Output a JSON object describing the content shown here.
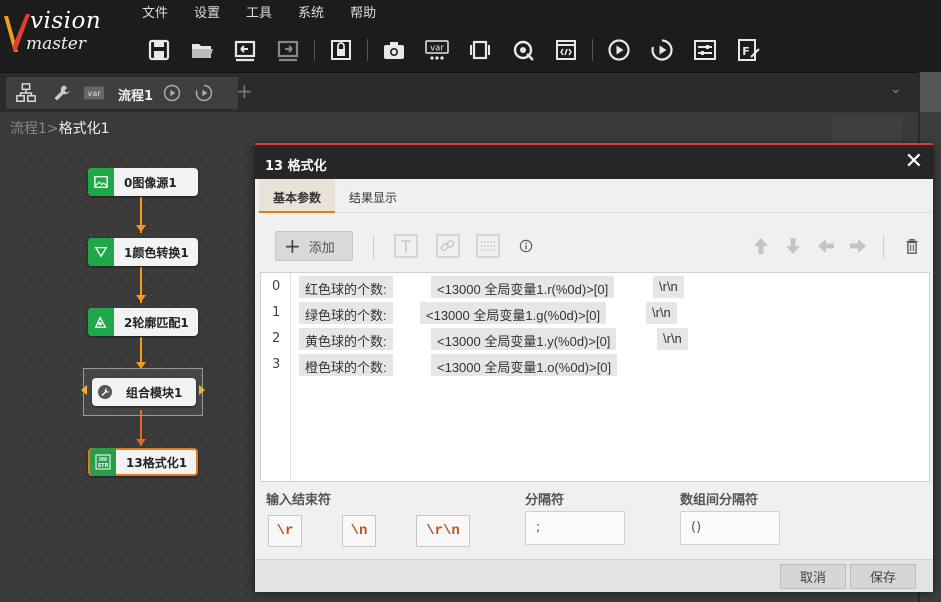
{
  "app": {
    "logo_text_top": "vision",
    "logo_text_bottom": "master"
  },
  "menu": [
    "文件",
    "设置",
    "工具",
    "系统",
    "帮助"
  ],
  "toolbar_icons": [
    "save-icon",
    "open-folder-icon",
    "import-icon",
    "export-icon",
    "lock-icon",
    "camera-icon",
    "variable-icon",
    "controller-icon",
    "global-trigger-icon",
    "script-icon",
    "run-once-icon",
    "run-loop-icon",
    "settings-icon",
    "form-icon"
  ],
  "process_tab": {
    "label": "流程1"
  },
  "breadcrumb": {
    "parent": "流程1",
    "separator": ">",
    "current": "格式化1"
  },
  "nodes": [
    {
      "label": "0图像源1",
      "icon": "image-icon"
    },
    {
      "label": "1颜色转换1",
      "icon": "color-convert-icon"
    },
    {
      "label": "2轮廓匹配1",
      "icon": "contour-match-icon"
    },
    {
      "label": "组合模块1",
      "icon": "wrench-icon"
    },
    {
      "label": "13格式化1",
      "icon": "str-icon"
    }
  ],
  "dialog": {
    "title": "13 格式化",
    "tabs": [
      "基本参数",
      "结果显示"
    ],
    "add_label": "添加",
    "lines": [
      {
        "num": "0",
        "label": "红色球的个数:",
        "expr": "<13000 全局变量1.r(%0d)>[0]",
        "term": "\\r\\n"
      },
      {
        "num": "1",
        "label": "绿色球的个数:",
        "expr": "<13000 全局变量1.g(%0d)>[0]",
        "term": "\\r\\n"
      },
      {
        "num": "2",
        "label": "黄色球的个数:",
        "expr": "<13000 全局变量1.y(%0d)>[0]",
        "term": "\\r\\n"
      },
      {
        "num": "3",
        "label": "橙色球的个数:",
        "expr": "<13000 全局变量1.o(%0d)>[0]",
        "term": ""
      }
    ],
    "input_end_label": "输入结束符",
    "end_buttons": [
      "\\r",
      "\\n",
      "\\r\\n"
    ],
    "separator_label": "分隔符",
    "separator_value": ";",
    "array_separator_label": "数组间分隔符",
    "array_separator_value": "()",
    "cancel_label": "取消",
    "save_label": "保存"
  },
  "colors": {
    "accent": "#e47a1e",
    "node_green": "#1fa84a",
    "connector": "#f29b1d",
    "dialog_top_border": "#e03a3a"
  }
}
